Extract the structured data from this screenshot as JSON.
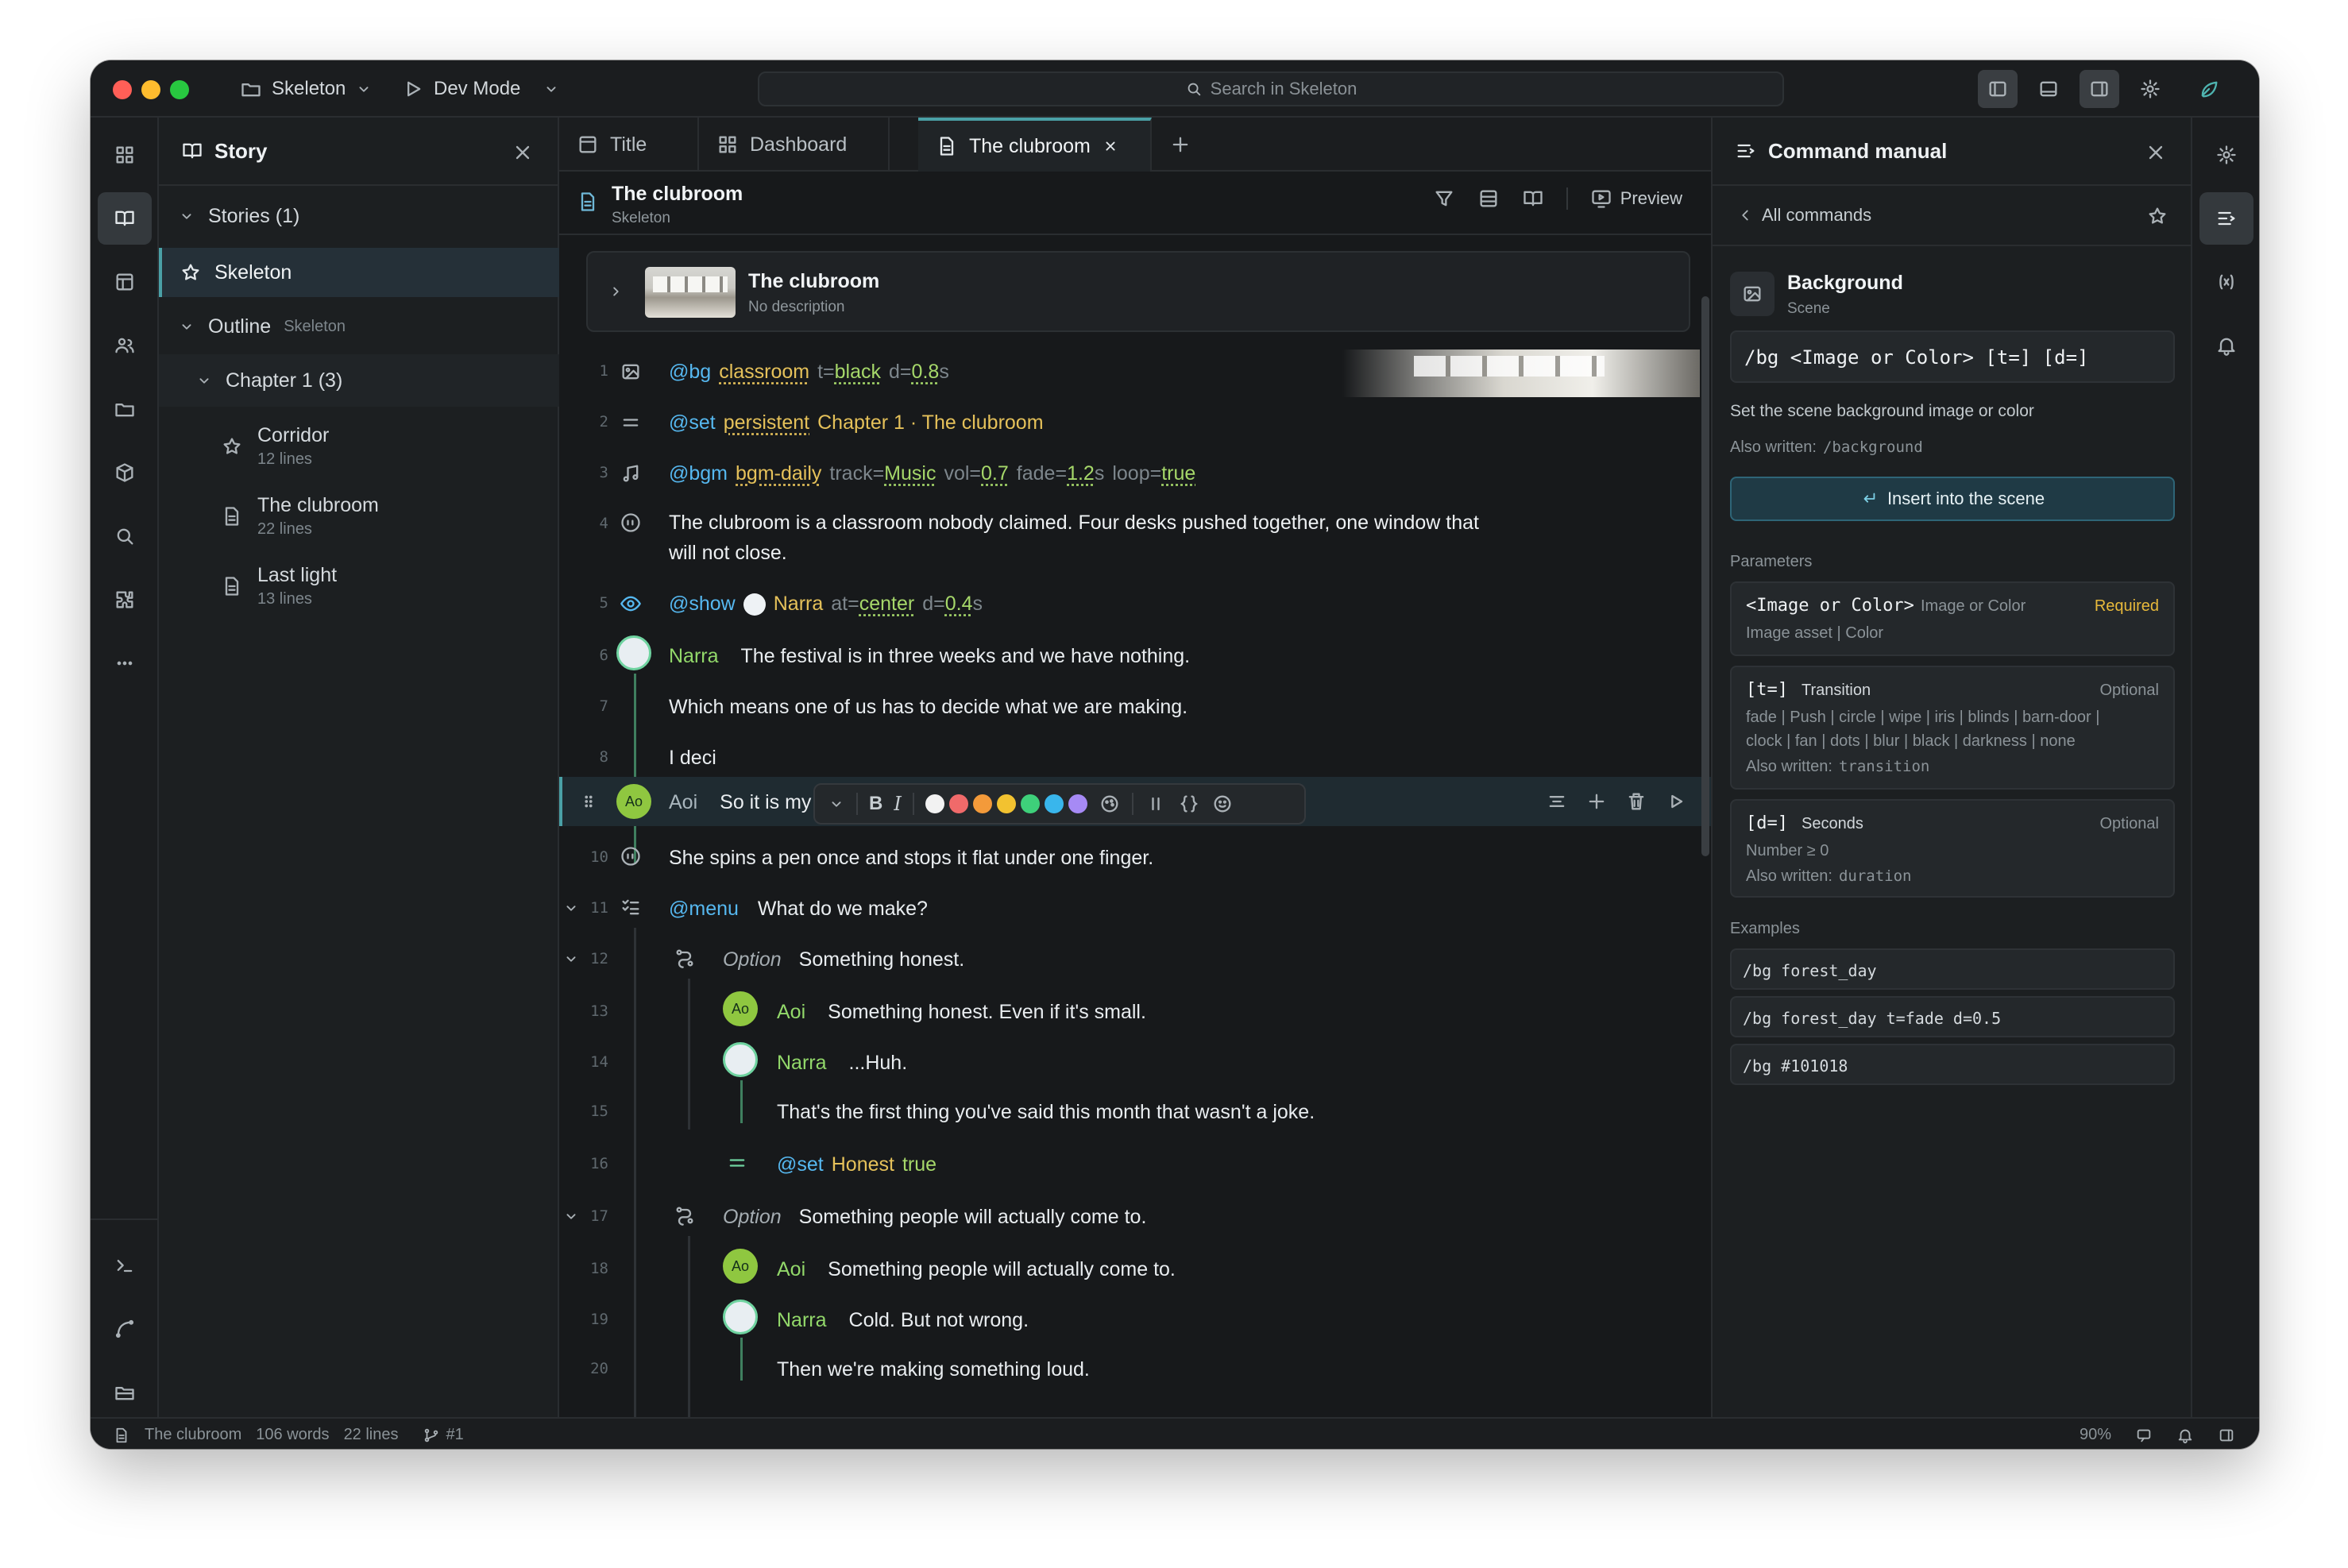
{
  "titlebar": {
    "project": "Skeleton",
    "mode": "Dev Mode",
    "search_placeholder": "Search in Skeleton"
  },
  "story_panel": {
    "title": "Story",
    "stories_label": "Stories (1)",
    "skeleton": "Skeleton",
    "outline_label": "Outline",
    "outline_sub": "Skeleton",
    "chapter": "Chapter 1 (3)",
    "scenes": [
      {
        "title": "Corridor",
        "sub": "12 lines"
      },
      {
        "title": "The clubroom",
        "sub": "22 lines"
      },
      {
        "title": "Last light",
        "sub": "13 lines"
      }
    ]
  },
  "tabs": [
    {
      "label": "Title"
    },
    {
      "label": "Dashboard"
    },
    {
      "label": "The clubroom"
    }
  ],
  "doc": {
    "title": "The clubroom",
    "subtitle": "Skeleton",
    "preview_label": "Preview",
    "scene_title": "The clubroom",
    "scene_desc": "No description"
  },
  "script": {
    "l1": {
      "n": "1",
      "cmd": "@bg",
      "arg": "classroom",
      "k1": "t=",
      "v1": "black",
      "k2": "d=",
      "v2": "0.8",
      "u2": "s"
    },
    "l2": {
      "n": "2",
      "cmd": "@set",
      "arg": "persistent",
      "rest": "Chapter 1 · The clubroom"
    },
    "l3": {
      "n": "3",
      "cmd": "@bgm",
      "arg": "bgm-daily",
      "k1": "track=",
      "v1": "Music",
      "k2": "vol=",
      "v2": "0.7",
      "k3": "fade=",
      "v3": "1.2",
      "u3": "s",
      "k4": "loop=",
      "v4": "true"
    },
    "l4": {
      "n": "4",
      "text_a": "The clubroom is a classroom nobody claimed. Four desks pushed together, one window that",
      "text_b": "will not close."
    },
    "l5": {
      "n": "5",
      "cmd": "@show",
      "arg": "Narra",
      "k1": "at=",
      "v1": "center",
      "k2": "d=",
      "v2": "0.4",
      "u2": "s"
    },
    "l6": {
      "n": "6",
      "speaker": "Narra",
      "text": "The festival is in three weeks and we have nothing."
    },
    "l7": {
      "n": "7",
      "text": "Which means one of us has to decide what we are making."
    },
    "l8": {
      "n": "8",
      "text": "I deci"
    },
    "l9": {
      "avatar": "Ao",
      "speaker": "Aoi",
      "text": "So it is my turn."
    },
    "l10": {
      "n": "10",
      "text": "She spins a pen once and stops it flat under one finger."
    },
    "l11": {
      "n": "11",
      "cmd": "@menu",
      "text": "What do we make?"
    },
    "l12": {
      "n": "12",
      "label": "Option",
      "text": "Something honest."
    },
    "l13": {
      "n": "13",
      "avatar": "Ao",
      "speaker": "Aoi",
      "text": "Something honest. Even if it's small."
    },
    "l14": {
      "n": "14",
      "speaker": "Narra",
      "text": "...Huh."
    },
    "l15": {
      "n": "15",
      "text": "That's the first thing you've said this month that wasn't a joke."
    },
    "l16": {
      "n": "16",
      "cmd": "@set",
      "arg": "Honest",
      "val": "true"
    },
    "l17": {
      "n": "17",
      "label": "Option",
      "text": "Something people will actually come to."
    },
    "l18": {
      "n": "18",
      "avatar": "Ao",
      "speaker": "Aoi",
      "text": "Something people will actually come to."
    },
    "l19": {
      "n": "19",
      "speaker": "Narra",
      "text": "Cold. But not wrong."
    },
    "l20": {
      "n": "20",
      "text": "Then we're making something loud."
    }
  },
  "format_toolbar": {
    "colors": [
      "#f2f2f2",
      "#f06a6a",
      "#f39a3a",
      "#f2c230",
      "#3ed07a",
      "#39b6ec",
      "#a68af5"
    ]
  },
  "manual": {
    "title": "Command manual",
    "back_label": "All commands",
    "command_name": "Background",
    "command_cat": "Scene",
    "syntax": "/bg <Image or Color> [t=] [d=]",
    "description": "Set the scene background image or color",
    "also_written_label": "Also written:",
    "also_written": "/background",
    "insert_label": "Insert into the scene",
    "parameters_label": "Parameters",
    "params": [
      {
        "name": "<Image or Color>",
        "type": "Image or Color",
        "flag": "Required",
        "desc": "Image asset | Color"
      },
      {
        "name": "[t=]",
        "type": "Transition",
        "flag": "Optional",
        "desc_a": "fade | Push | circle | wipe | iris | blinds | barn-door |",
        "desc_b": "clock | fan | dots | blur | black | darkness | none",
        "alias": "transition"
      },
      {
        "name": "[d=]",
        "type": "Seconds",
        "flag": "Optional",
        "desc": "Number ≥ 0",
        "alias": "duration"
      }
    ],
    "examples_label": "Examples",
    "examples": [
      "/bg forest_day",
      "/bg forest_day t=fade d=0.5",
      "/bg #101018"
    ]
  },
  "status": {
    "scene": "The clubroom",
    "words": "106 words",
    "lines": "22 lines",
    "branch": "#1",
    "zoom": "90%"
  }
}
